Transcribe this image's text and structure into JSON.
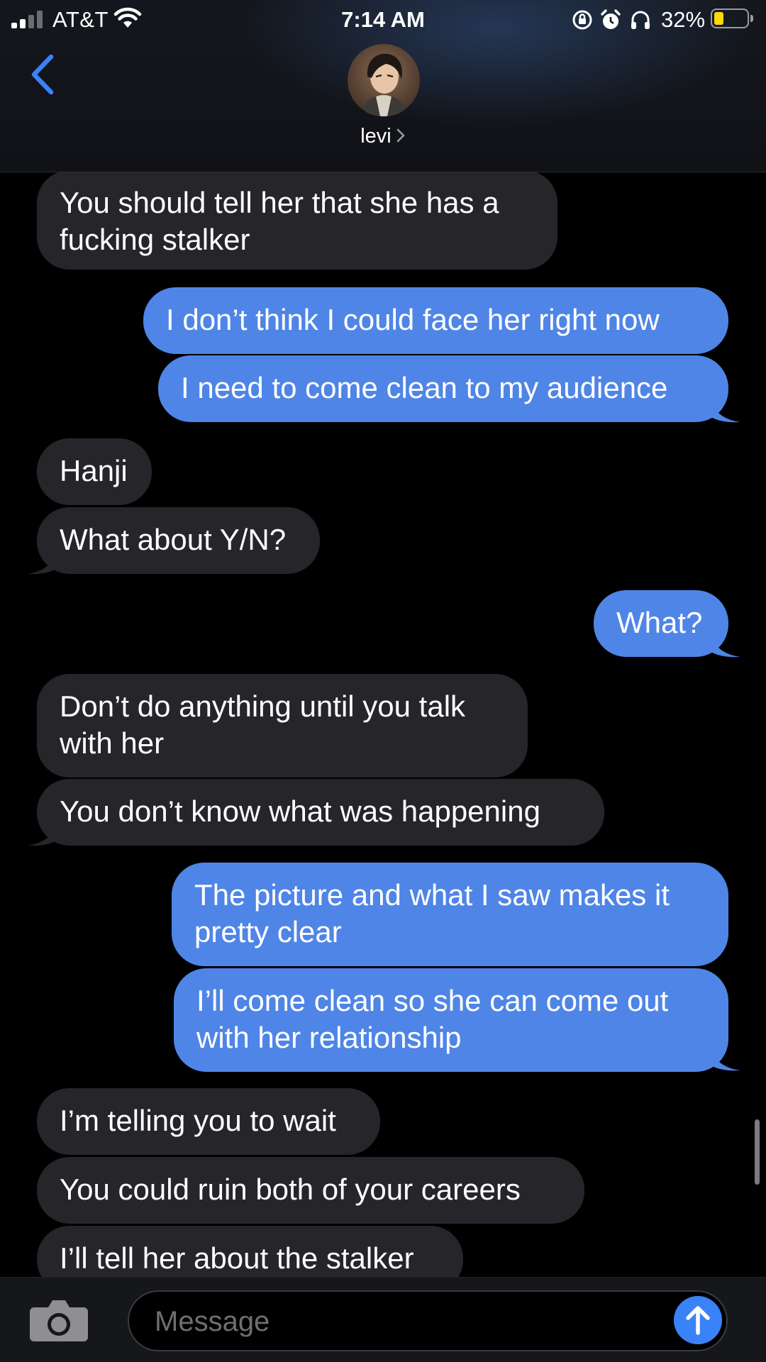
{
  "status_bar": {
    "carrier": "AT&T",
    "time": "7:14 AM",
    "battery_percent": "32%",
    "battery_level": 0.32,
    "battery_color": "#ffd60a",
    "icons": [
      "signal-icon",
      "wifi-icon",
      "orientation-lock-icon",
      "alarm-icon",
      "headphones-icon",
      "battery-icon"
    ]
  },
  "header": {
    "back_icon": "chevron-left-icon",
    "contact_name": "levi",
    "contact_chevron": "chevron-right-icon",
    "accent_color": "#3a82f7"
  },
  "colors": {
    "incoming_bubble": "#26262a",
    "outgoing_bubble": "#4f85e6",
    "background": "#000000"
  },
  "messages": [
    {
      "direction": "in",
      "text": "You should tell her that she has a\nfucking stalker"
    },
    {
      "direction": "out",
      "text": "I don’t think I could face her right now"
    },
    {
      "direction": "out",
      "text": "I need to come clean to my audience"
    },
    {
      "direction": "in",
      "text": "Hanji"
    },
    {
      "direction": "in",
      "text": "What about Y/N?"
    },
    {
      "direction": "out",
      "text": "What?"
    },
    {
      "direction": "in",
      "text": "Don’t do anything until you talk\nwith her"
    },
    {
      "direction": "in",
      "text": "You don’t know what was happening"
    },
    {
      "direction": "out",
      "text": "The picture and what I saw makes it\npretty clear"
    },
    {
      "direction": "out",
      "text": "I’ll come clean so she can come out\nwith her relationship"
    },
    {
      "direction": "in",
      "text": "I’m telling you to wait"
    },
    {
      "direction": "in",
      "text": "You could ruin both of your careers"
    },
    {
      "direction": "in",
      "text": "I’ll tell her about the stalker"
    }
  ],
  "input": {
    "placeholder": "Message",
    "camera_icon": "camera-icon",
    "send_icon": "arrow-up-icon"
  }
}
